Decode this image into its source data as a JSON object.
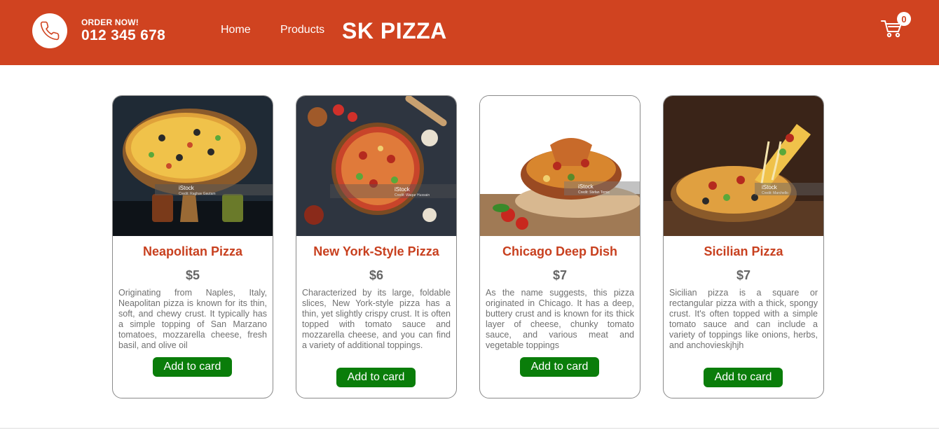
{
  "header": {
    "order_label": "ORDER NOW!",
    "phone_number": "012 345 678",
    "nav": {
      "home": "Home",
      "products": "Products"
    },
    "brand": "SK PIZZA",
    "cart_count": "0",
    "background_color": "#d04320"
  },
  "products": [
    {
      "name": "Neapolitan Pizza",
      "price": "$5",
      "description": "Originating from Naples, Italy, Neapolitan pizza is known for its thin, soft, and chewy crust. It typically has a simple topping of San Marzano tomatoes, mozzarella cheese, fresh basil, and olive oil",
      "button": "Add to card",
      "watermark": "iStock",
      "credit": "Credit: Raghav Gautam"
    },
    {
      "name": "New York-Style Pizza",
      "price": "$6",
      "description": "Characterized by its large, foldable slices, New York-style pizza has a thin, yet slightly crispy crust. It is often topped with tomato sauce and mozzarella cheese, and you can find a variety of additional toppings.",
      "button": "Add to card",
      "watermark": "iStock",
      "credit": "Credit: Waqar Hussain"
    },
    {
      "name": "Chicago Deep Dish",
      "price": "$7",
      "description": "As the name suggests, this pizza originated in Chicago. It has a deep, buttery crust and is known for its thick layer of cheese, chunky tomato sauce, and various meat and vegetable toppings",
      "button": "Add to card",
      "watermark": "iStock",
      "credit": "Credit: Stefan Tomic"
    },
    {
      "name": "Sicilian Pizza",
      "price": "$7",
      "description": "Sicilian pizza is a square or rectangular pizza with a thick, spongy crust. It's often topped with a simple tomato sauce and can include a variety of toppings like onions, herbs, and anchovieskjhjh",
      "button": "Add to card",
      "watermark": "iStock",
      "credit": "Credit: Marchello"
    }
  ]
}
